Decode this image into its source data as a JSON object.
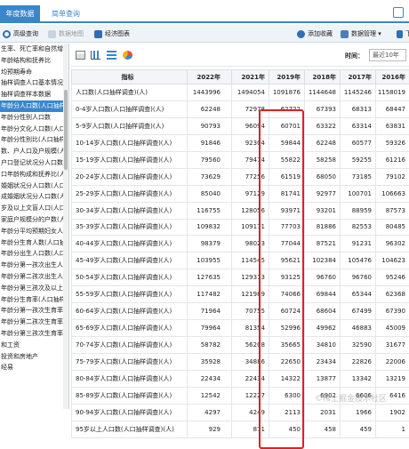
{
  "tabs": {
    "annual": "年度数据",
    "simple": "简单查询"
  },
  "toolbar": {
    "advanced": "高级查询",
    "map": "数据地图",
    "charts": "经济图表",
    "favorite": "添加收藏",
    "manage": "数据管理",
    "next": "下"
  },
  "sidebar": {
    "items": [
      {
        "label": "生率、死亡率和自然增长"
      },
      {
        "label": "年龄结构和抚养比"
      },
      {
        "label": "均预期寿命"
      },
      {
        "label": "抽样调查人口基本情况"
      },
      {
        "label": "抽样调查样本数据"
      },
      {
        "label": "年龄分人口数(人口抽样调查)",
        "active": true
      },
      {
        "label": "年龄分性别人口数"
      },
      {
        "label": "年龄分文化人口数(人口抽样调查)"
      },
      {
        "label": "年龄分性别比(人口抽样调查)"
      },
      {
        "label": "数、户人口及户规模(人口抽样调查)"
      },
      {
        "label": "户口登记状况分人口数(人口抽样调查)"
      },
      {
        "label": "口年龄构成和抚养比(人口抽样调查)"
      },
      {
        "label": "婚姻状况分人口数(人口抽样调查)"
      },
      {
        "label": "成婚姻状况分人口数(人口抽样调查)"
      },
      {
        "label": "岁及以上文盲人口(人口抽样调查)"
      },
      {
        "label": "家庭户规模分的户数(人口抽样调查)"
      },
      {
        "label": "年龄分平均预期妇女人数(人口抽样调查)"
      },
      {
        "label": "年龄分生育人数(人口抽样调查)"
      },
      {
        "label": "年龄分出生人口数(人口抽样调查)"
      },
      {
        "label": "年龄分第一孩次出生人口数(人口抽样调查)"
      },
      {
        "label": "年龄分第二孩次出生人口数(人口抽样调查)"
      },
      {
        "label": "年龄分第三孩次及以上出生人口数(人口抽样调查)"
      },
      {
        "label": "年龄分生育率(人口抽样调查)"
      },
      {
        "label": "年龄分第一孩次生育率(人口抽样调查)"
      },
      {
        "label": "年龄分第二孩次生育率(人口抽样调查)"
      },
      {
        "label": "年龄分第三孩次生育率(人口抽样调查)"
      },
      {
        "label": "和工资"
      },
      {
        "label": "投资和房地产"
      },
      {
        "label": "经易"
      }
    ]
  },
  "time": {
    "label": "时间：",
    "value": "最近10年"
  },
  "table": {
    "columns": [
      "指标",
      "2022年",
      "2021年",
      "2019年",
      "2018年",
      "2017年",
      "2016年"
    ],
    "rows": [
      {
        "name": "人口数(人口抽样调查)(人)",
        "v": [
          "1443996",
          "1494054",
          "1091876",
          "1144648",
          "1145246",
          "1158019",
          "11"
        ]
      },
      {
        "name": "0-4岁人口数(人口抽样调查)(人)",
        "v": [
          "62248",
          "72978",
          "62722",
          "67393",
          "68313",
          "68447"
        ]
      },
      {
        "name": "5-9岁人口数(人口抽样调查)(人)",
        "v": [
          "90793",
          "96094",
          "60701",
          "63322",
          "63314",
          "63831"
        ]
      },
      {
        "name": "10-14岁人口数(人口抽样调查)(人)",
        "v": [
          "91846",
          "92304",
          "59844",
          "62248",
          "60577",
          "59326"
        ]
      },
      {
        "name": "15-19岁人口数(人口抽样调查)(人)",
        "v": [
          "79560",
          "79414",
          "55822",
          "58258",
          "59255",
          "61216"
        ]
      },
      {
        "name": "20-24岁人口数(人口抽样调查)(人)",
        "v": [
          "73629",
          "77256",
          "61519",
          "68050",
          "73185",
          "79102"
        ]
      },
      {
        "name": "25-29岁人口数(人口抽样调查)(人)",
        "v": [
          "85040",
          "97129",
          "81741",
          "92977",
          "100701",
          "106663"
        ]
      },
      {
        "name": "30-34岁人口数(人口抽样调查)(人)",
        "v": [
          "116755",
          "128056",
          "93971",
          "93201",
          "88959",
          "87573"
        ]
      },
      {
        "name": "35-39岁人口数(人口抽样调查)(人)",
        "v": [
          "109832",
          "109171",
          "77703",
          "81886",
          "82553",
          "80485"
        ]
      },
      {
        "name": "40-44岁人口数(人口抽样调查)(人)",
        "v": [
          "98379",
          "98023",
          "77044",
          "87521",
          "91231",
          "96302"
        ]
      },
      {
        "name": "45-49岁人口数(人口抽样调查)(人)",
        "v": [
          "103955",
          "114545",
          "95621",
          "102384",
          "105476",
          "104623"
        ]
      },
      {
        "name": "50-54岁人口数(人口抽样调查)(人)",
        "v": [
          "127635",
          "129313",
          "93125",
          "96760",
          "96760",
          "95246"
        ]
      },
      {
        "name": "55-59岁人口数(人口抽样调查)(人)",
        "v": [
          "117482",
          "121989",
          "74066",
          "69844",
          "65344",
          "62368"
        ]
      },
      {
        "name": "60-64岁人口数(人口抽样调查)(人)",
        "v": [
          "71964",
          "70755",
          "60724",
          "68604",
          "67499",
          "67390"
        ]
      },
      {
        "name": "65-69岁人口数(人口抽样调查)(人)",
        "v": [
          "79964",
          "81354",
          "52996",
          "49962",
          "46883",
          "45009"
        ]
      },
      {
        "name": "70-74岁人口数(人口抽样调查)(人)",
        "v": [
          "58782",
          "56208",
          "35665",
          "34810",
          "32590",
          "31677"
        ]
      },
      {
        "name": "75-79岁人口数(人口抽样调查)(人)",
        "v": [
          "35928",
          "34886",
          "22650",
          "23434",
          "22826",
          "22006"
        ]
      },
      {
        "name": "80-84岁人口数(人口抽样调查)(人)",
        "v": [
          "22434",
          "22434",
          "14322",
          "13877",
          "13342",
          "13219"
        ]
      },
      {
        "name": "85-89岁人口数(人口抽样调查)(人)",
        "v": [
          "12542",
          "12227",
          "6300",
          "6902",
          "6606",
          "6416"
        ]
      },
      {
        "name": "90-94岁人口数(人口抽样调查)(人)",
        "v": [
          "4297",
          "4249",
          "2113",
          "2031",
          "1966",
          "1902"
        ]
      },
      {
        "name": "95岁以上人口数(人口抽样调查)(人)",
        "v": [
          "929",
          "871",
          "450",
          "458",
          "459",
          "1"
        ]
      }
    ]
  },
  "watermark": "©稀土掘金技术社区"
}
